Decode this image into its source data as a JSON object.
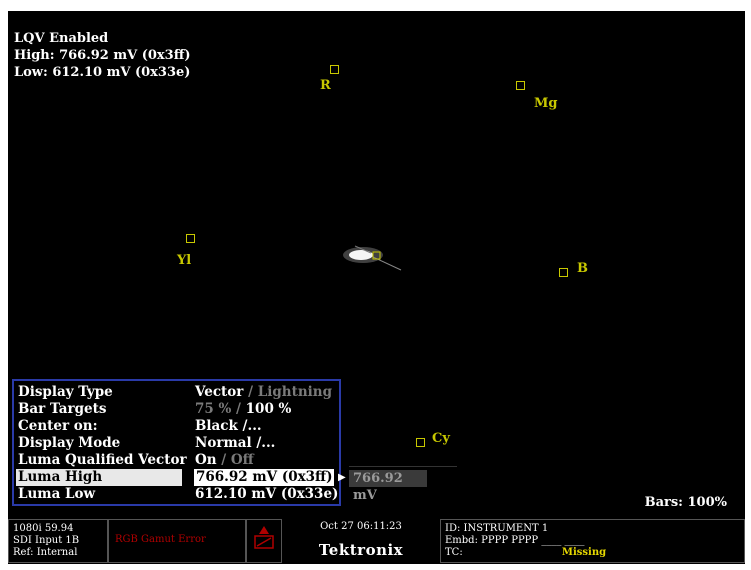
{
  "lqv": {
    "status": "LQV Enabled",
    "high": "High: 766.92 mV (0x3ff)",
    "low": "Low: 612.10 mV (0x33e)"
  },
  "targets": {
    "r": "R",
    "mg": "Mg",
    "yl": "Yl",
    "b": "B",
    "cy": "Cy"
  },
  "menu": {
    "display_type": {
      "label": "Display Type",
      "value": "Vector",
      "alt": "/ Lightning"
    },
    "bar_targets": {
      "label": "Bar Targets",
      "alt": "75 % /",
      "value": "100 %"
    },
    "center_on": {
      "label": "Center on:",
      "value": "Black /..."
    },
    "display_mode": {
      "label": "Display Mode",
      "value": "Normal /..."
    },
    "luma_qualified": {
      "label": "Luma Qualified Vector",
      "value": "On",
      "alt": "/ Off"
    },
    "luma_high": {
      "label": "Luma High",
      "value": "766.92 mV (0x3ff)"
    },
    "luma_low": {
      "label": "Luma Low",
      "value": "612.10 mV (0x33e)"
    }
  },
  "edit_value": "766.92 mV",
  "bars": "Bars: 100%",
  "status": {
    "format": "1080i 59.94",
    "input": "SDI Input 1B",
    "ref": "Ref: Internal",
    "alarm": "RGB Gamut Error",
    "datetime": "Oct 27 06:11:23",
    "brand": "Tektronix",
    "id": "ID: INSTRUMENT 1",
    "embd": "Embd: PPPP PPPP ____ ____",
    "tc_label": "TC:",
    "tc_value": "Missing"
  },
  "icons": {
    "alarm_icon": "warning-bell-icon",
    "submenu_arrow": "right-arrow-icon"
  },
  "colors": {
    "target": "#c8c800",
    "menu_border": "#2a3aa8",
    "alarm": "#b00000",
    "missing": "#e6d800"
  }
}
